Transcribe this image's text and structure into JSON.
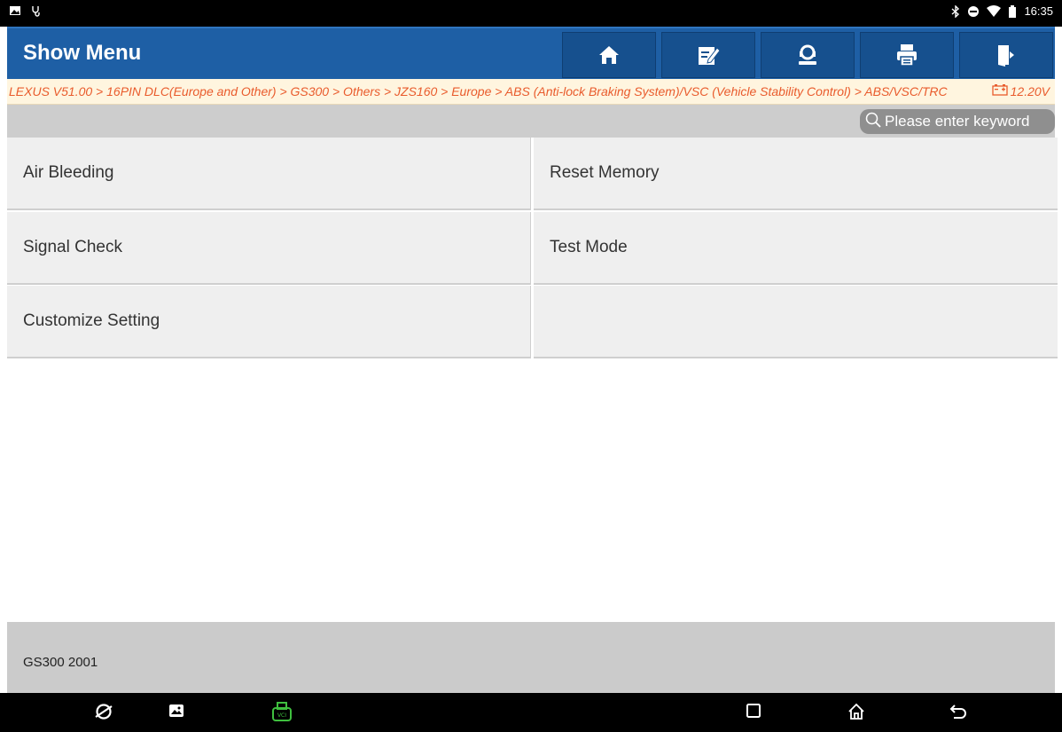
{
  "status_bar": {
    "time": "16:35",
    "left_icons": [
      "image-notification-icon",
      "diagnostic-notification-icon"
    ],
    "right_icons": [
      "bluetooth-icon",
      "do-not-disturb-icon",
      "wifi-icon",
      "battery-icon"
    ]
  },
  "header": {
    "title": "Show Menu",
    "buttons": [
      "home-icon",
      "edit-report-icon",
      "remote-help-icon",
      "print-icon",
      "exit-icon"
    ]
  },
  "breadcrumb": {
    "path": "LEXUS V51.00 > 16PIN DLC(Europe and Other) > GS300 > Others > JZS160 > Europe > ABS (Anti-lock Braking System)/VSC (Vehicle Stability Control) > ABS/VSC/TRC",
    "voltage": "12.20V"
  },
  "search": {
    "placeholder": "Please enter keyword"
  },
  "menu": {
    "items": [
      {
        "label": "Air Bleeding"
      },
      {
        "label": "Reset Memory"
      },
      {
        "label": "Signal Check"
      },
      {
        "label": "Test Mode"
      },
      {
        "label": "Customize Setting"
      },
      {
        "label": ""
      }
    ]
  },
  "footer": {
    "vehicle_info": "GS300 2001"
  },
  "nav_bar": {
    "icons": [
      "browser-icon",
      "gallery-icon",
      "vci-icon",
      "recents-icon",
      "home-nav-icon",
      "back-icon"
    ]
  },
  "colors": {
    "header_blue": "#1e5fa5",
    "breadcrumb_text": "#e95b2c",
    "vci_green": "#3fbf3f"
  }
}
